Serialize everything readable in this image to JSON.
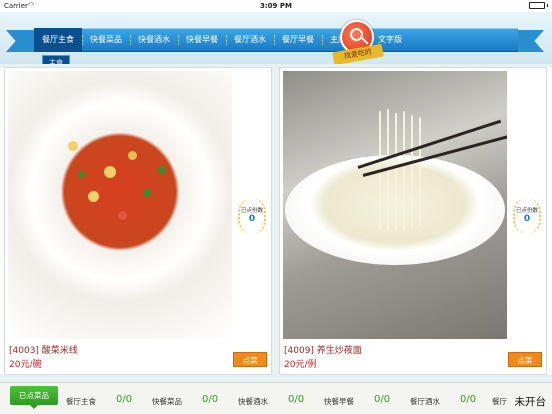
{
  "status_bar": {
    "carrier": "Carrier",
    "wifi_icon": "wifi-icon",
    "time": "3:09 PM",
    "battery_icon": "battery-full-icon"
  },
  "nav": {
    "items": [
      {
        "label": "餐厅主食",
        "active": true
      },
      {
        "label": "快餐菜品"
      },
      {
        "label": "快餐酒水"
      },
      {
        "label": "快餐早餐"
      },
      {
        "label": "餐厅酒水"
      },
      {
        "label": "餐厅早餐"
      },
      {
        "label": "主厨推荐"
      },
      {
        "label": "文字版"
      }
    ],
    "subtab": "主食",
    "search_badge_label": "找爱吃的",
    "search_icon": "magnifier-icon"
  },
  "dishes": [
    {
      "name": "[4003] 酸菜米线",
      "price": "20元/碗",
      "count_label": "已点份数",
      "count": "0",
      "order_label": "点菜"
    },
    {
      "name": "[4009] 养生炒莜面",
      "price": "20元/例",
      "count_label": "已点份数",
      "count": "0",
      "order_label": "点菜"
    }
  ],
  "summary": {
    "ordered_label": "已点菜品",
    "categories": [
      {
        "name": "餐厅主食",
        "value": "0/0"
      },
      {
        "name": "快餐菜品",
        "value": "0/0"
      },
      {
        "name": "快餐酒水",
        "value": "0/0"
      },
      {
        "name": "快餐早餐",
        "value": "0/0"
      },
      {
        "name": "餐厅酒水",
        "value": "0/0"
      },
      {
        "name": "餐厅",
        "value": ""
      }
    ],
    "status": "未开台"
  },
  "colors": {
    "nav_blue": "#1b78c3",
    "nav_active": "#0a4f8f",
    "order_button": "#f08a1c",
    "count_value": "#1a7ad0",
    "price_red": "#cc2222",
    "ordered_green": "#2e9a21"
  }
}
